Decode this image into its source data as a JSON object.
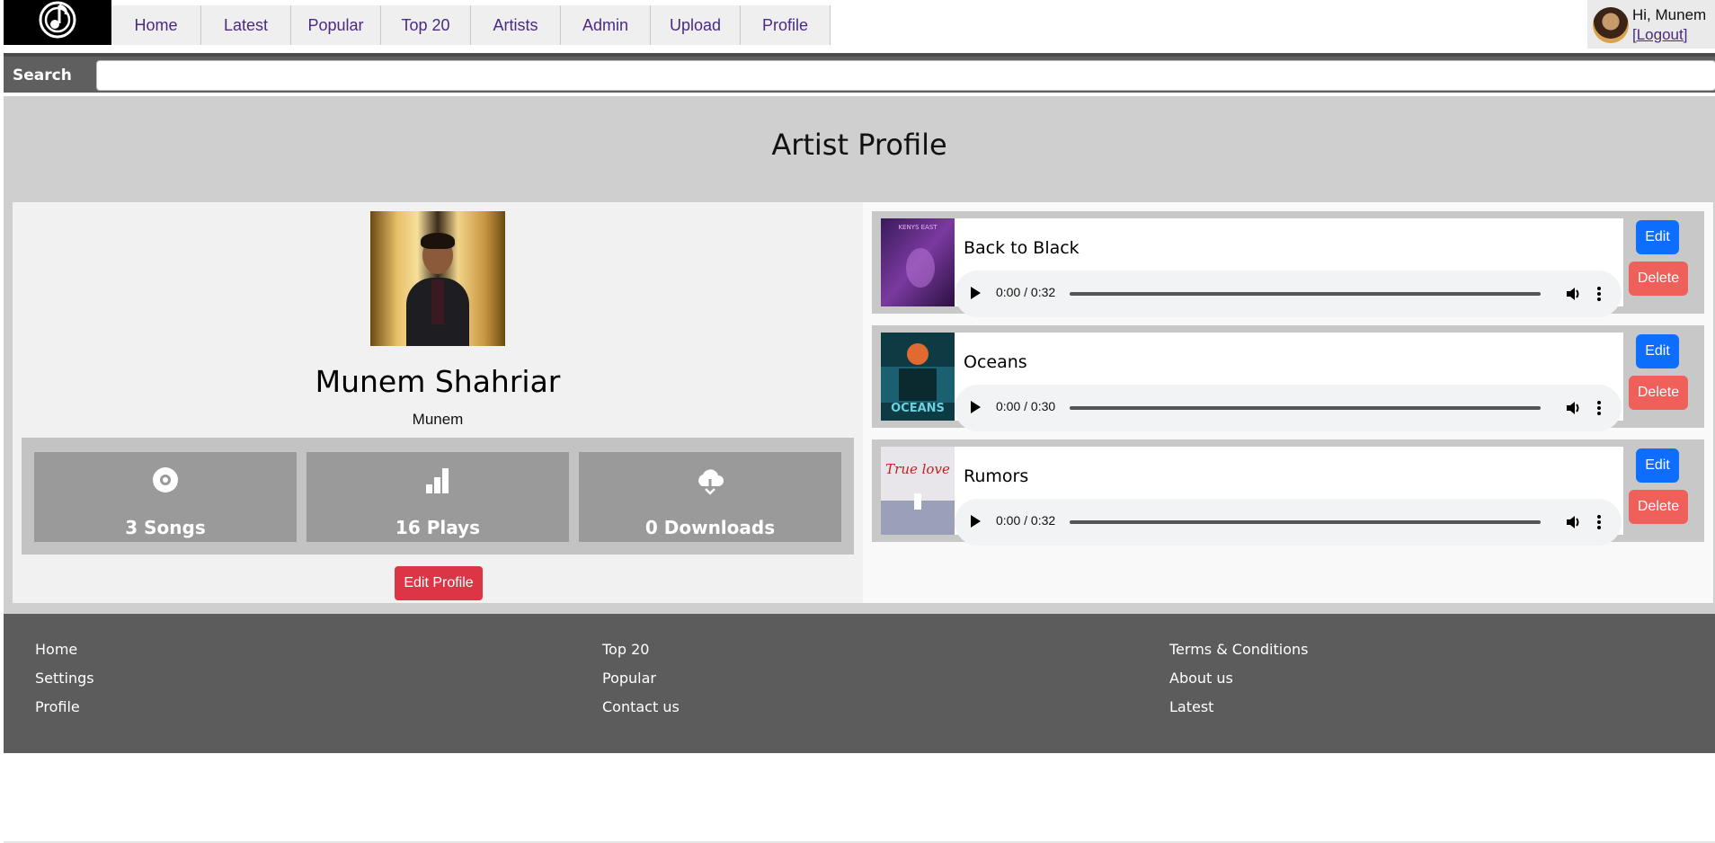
{
  "nav": {
    "items": [
      "Home",
      "Latest",
      "Popular",
      "Top 20",
      "Artists",
      "Admin",
      "Upload",
      "Profile"
    ]
  },
  "user": {
    "greeting": "Hi, Munem",
    "logout_label": "[Logout]"
  },
  "search": {
    "label": "Search",
    "value": "",
    "placeholder": ""
  },
  "page": {
    "title": "Artist Profile"
  },
  "artist": {
    "name": "Munem Shahriar",
    "username": "Munem",
    "stats": [
      {
        "label": "3 Songs",
        "icon": "disc-icon"
      },
      {
        "label": "16 Plays",
        "icon": "bar-chart-icon"
      },
      {
        "label": "0 Downloads",
        "icon": "cloud-download-icon"
      }
    ],
    "edit_profile_label": "Edit Profile"
  },
  "songs": [
    {
      "title": "Back to Black",
      "time": "0:00 / 0:32",
      "cover_text": "KENYS EAST",
      "edit_label": "Edit",
      "delete_label": "Delete"
    },
    {
      "title": "Oceans",
      "time": "0:00 / 0:30",
      "cover_text": "OCEANS",
      "edit_label": "Edit",
      "delete_label": "Delete"
    },
    {
      "title": "Rumors",
      "time": "0:00 / 0:32",
      "cover_text": "True love",
      "edit_label": "Edit",
      "delete_label": "Delete"
    }
  ],
  "footer": {
    "col1": [
      "Home",
      "Settings",
      "Profile"
    ],
    "col2": [
      "Top 20",
      "Popular",
      "Contact us"
    ],
    "col3": [
      "Terms & Conditions",
      "About us",
      "Latest"
    ]
  },
  "colors": {
    "link_purple": "#4b2a80",
    "edit_blue": "#0d6efd",
    "delete_red": "#f0605a",
    "edit_profile_red": "#dc3545",
    "footer_gray": "#5c5c5c"
  }
}
